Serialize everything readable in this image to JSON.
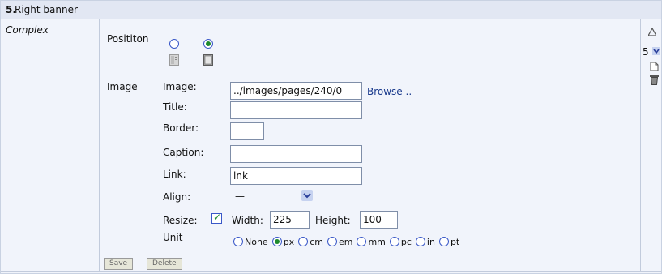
{
  "section": {
    "number": "5.",
    "title": "Right banner"
  },
  "left_label": "Complex",
  "position": {
    "label": "Posititon",
    "options": [
      {
        "icon": "layout-left-icon",
        "selected": false
      },
      {
        "icon": "layout-right-icon",
        "selected": true
      }
    ]
  },
  "image_group": {
    "label": "Image",
    "fields": {
      "image": {
        "label": "Image:",
        "value": "../images/pages/240/0"
      },
      "title": {
        "label": "Title:",
        "value": ""
      },
      "border": {
        "label": "Border:",
        "value": ""
      },
      "caption": {
        "label": "Caption:",
        "value": ""
      },
      "link": {
        "label": "Link:",
        "value": "lnk"
      },
      "align": {
        "label": "Align:",
        "value": "—"
      }
    },
    "browse": "Browse ..",
    "resize": {
      "label": "Resize:",
      "checked": true,
      "width_label": "Width:",
      "width": "225",
      "height_label": "Height:",
      "height": "100"
    },
    "unit": {
      "label": "Unit",
      "options": [
        {
          "label": "None",
          "selected": false
        },
        {
          "label": "px",
          "selected": true
        },
        {
          "label": "cm",
          "selected": false
        },
        {
          "label": "em",
          "selected": false
        },
        {
          "label": "mm",
          "selected": false
        },
        {
          "label": "pc",
          "selected": false
        },
        {
          "label": "in",
          "selected": false
        },
        {
          "label": "pt",
          "selected": false
        }
      ]
    }
  },
  "buttons": {
    "save": "Save",
    "delete": "Delete"
  },
  "order": {
    "value": "5"
  },
  "icons": [
    "move-up-icon",
    "order-select-chevron-icon",
    "new-page-icon",
    "trash-icon"
  ],
  "colors": {
    "header_bg": "#e2e7f3",
    "panel_bg": "#f1f4fb",
    "radio_border": "#3a58c8",
    "radio_dot": "#1f8a2e",
    "link": "#1a3a8c"
  }
}
